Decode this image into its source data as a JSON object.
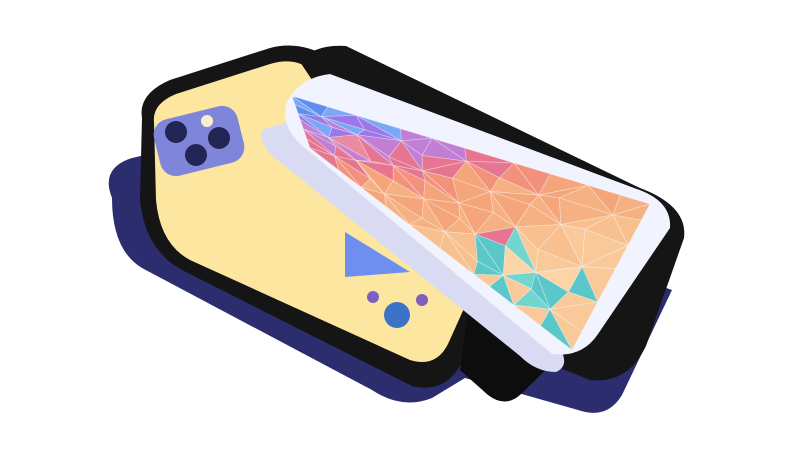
{
  "scene": {
    "subject": "phone-cases-illustration",
    "colors": {
      "background": "#ffffff",
      "shadow": "#2b2d6e",
      "case_black": "#151515",
      "back_yellow": "#fde7a0",
      "camera_bump": "#7f86d9",
      "lens_dark": "#232654",
      "flash": "#f6f0d0",
      "triangle_blue": "#6f8ff0",
      "dot_purple": "#7e5fc0",
      "dot_blue": "#3c73c8",
      "card_edge": "#f1f3ff",
      "card_shadow": "#d8dbf2",
      "slot_dark": "#0d0d0d"
    },
    "facet_palette": [
      "#5e8ff0",
      "#7aa8f5",
      "#9a78e8",
      "#c07fd4",
      "#e98aa0",
      "#f3927c",
      "#f5a57a",
      "#f6b183",
      "#f8c08e",
      "#f9c999",
      "#fbd5a8",
      "#72d6cf",
      "#5cc7c9",
      "#e57590"
    ]
  }
}
